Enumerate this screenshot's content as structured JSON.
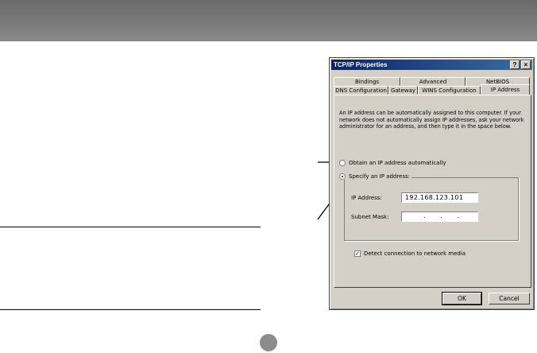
{
  "dialog": {
    "title": "TCP/IP Properties",
    "help_button": "?",
    "close_button": "×",
    "tabs_back": [
      "Bindings",
      "Advanced",
      "NetBIOS"
    ],
    "tabs_front": [
      "DNS Configuration",
      "Gateway",
      "WINS Configuration",
      "IP Address"
    ],
    "active_tab": "IP Address",
    "description": "An IP address can be automatically assigned to this computer. If your network does not automatically assign IP addresses, ask your network administrator for an address, and then type it in the space below.",
    "radio_auto": "Obtain an IP address automatically",
    "radio_specify": "Specify an IP address:",
    "ip_label": "IP Address:",
    "ip_value": "192.168.123.101",
    "subnet_label": "Subnet Mask:",
    "subnet_value": ". . .",
    "detect_label": "Detect connection to network media",
    "detect_checked": "✓",
    "ok_label": "OK",
    "cancel_label": "Cancel"
  },
  "colors": {
    "title_start": "#0a246a",
    "title_end": "#3a6ea5",
    "dialog_face": "#d4d0c8",
    "band": "#7a7a7a"
  }
}
